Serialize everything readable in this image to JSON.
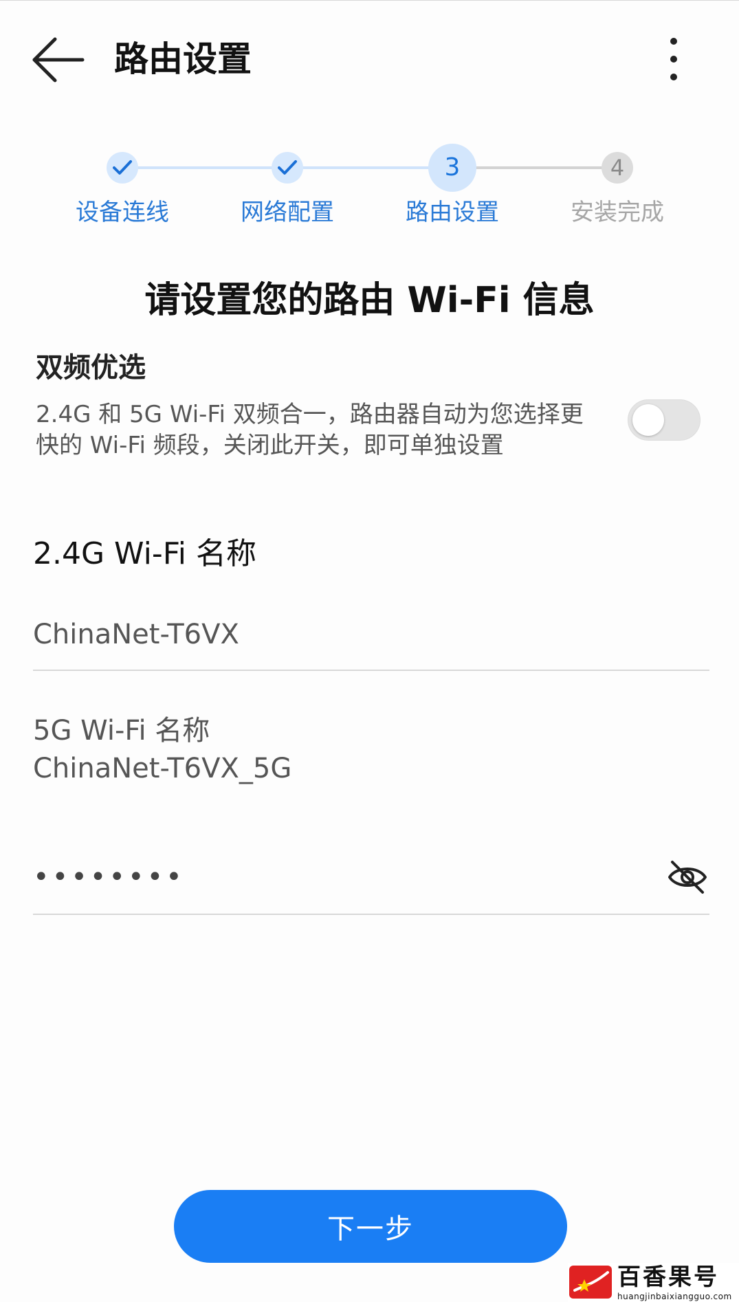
{
  "header": {
    "title": "路由设置",
    "back_icon": "arrow-left-icon",
    "more_icon": "more-vertical-icon"
  },
  "stepper": {
    "steps": [
      {
        "label": "设备连线",
        "status": "done",
        "marker": "check-icon"
      },
      {
        "label": "网络配置",
        "status": "done",
        "marker": "check-icon"
      },
      {
        "label": "路由设置",
        "status": "current",
        "marker": "3"
      },
      {
        "label": "安装完成",
        "status": "todo",
        "marker": "4"
      }
    ]
  },
  "main": {
    "heading": "请设置您的路由 Wi-Fi 信息"
  },
  "dual_band": {
    "title": "双频优选",
    "description": "2.4G 和 5G Wi-Fi 双频合一，路由器自动为您选择更快的 Wi-Fi 频段，关闭此开关，即可单独设置",
    "enabled": false
  },
  "wifi_24g": {
    "label": "2.4G Wi-Fi 名称",
    "value": "ChinaNet-T6VX"
  },
  "wifi_5g": {
    "label": "5G Wi-Fi 名称",
    "value": "ChinaNet-T6VX_5G"
  },
  "password": {
    "masked_value": "••••••••",
    "visibility_icon": "eye-off-icon"
  },
  "actions": {
    "next_label": "下一步"
  },
  "watermark": {
    "name": "百香果号",
    "url": "huangjinbaixiangguo.com"
  },
  "colors": {
    "accent": "#1a7ef4",
    "step_active_text": "#2a7ad6",
    "step_inactive_text": "#a6a6a6"
  }
}
